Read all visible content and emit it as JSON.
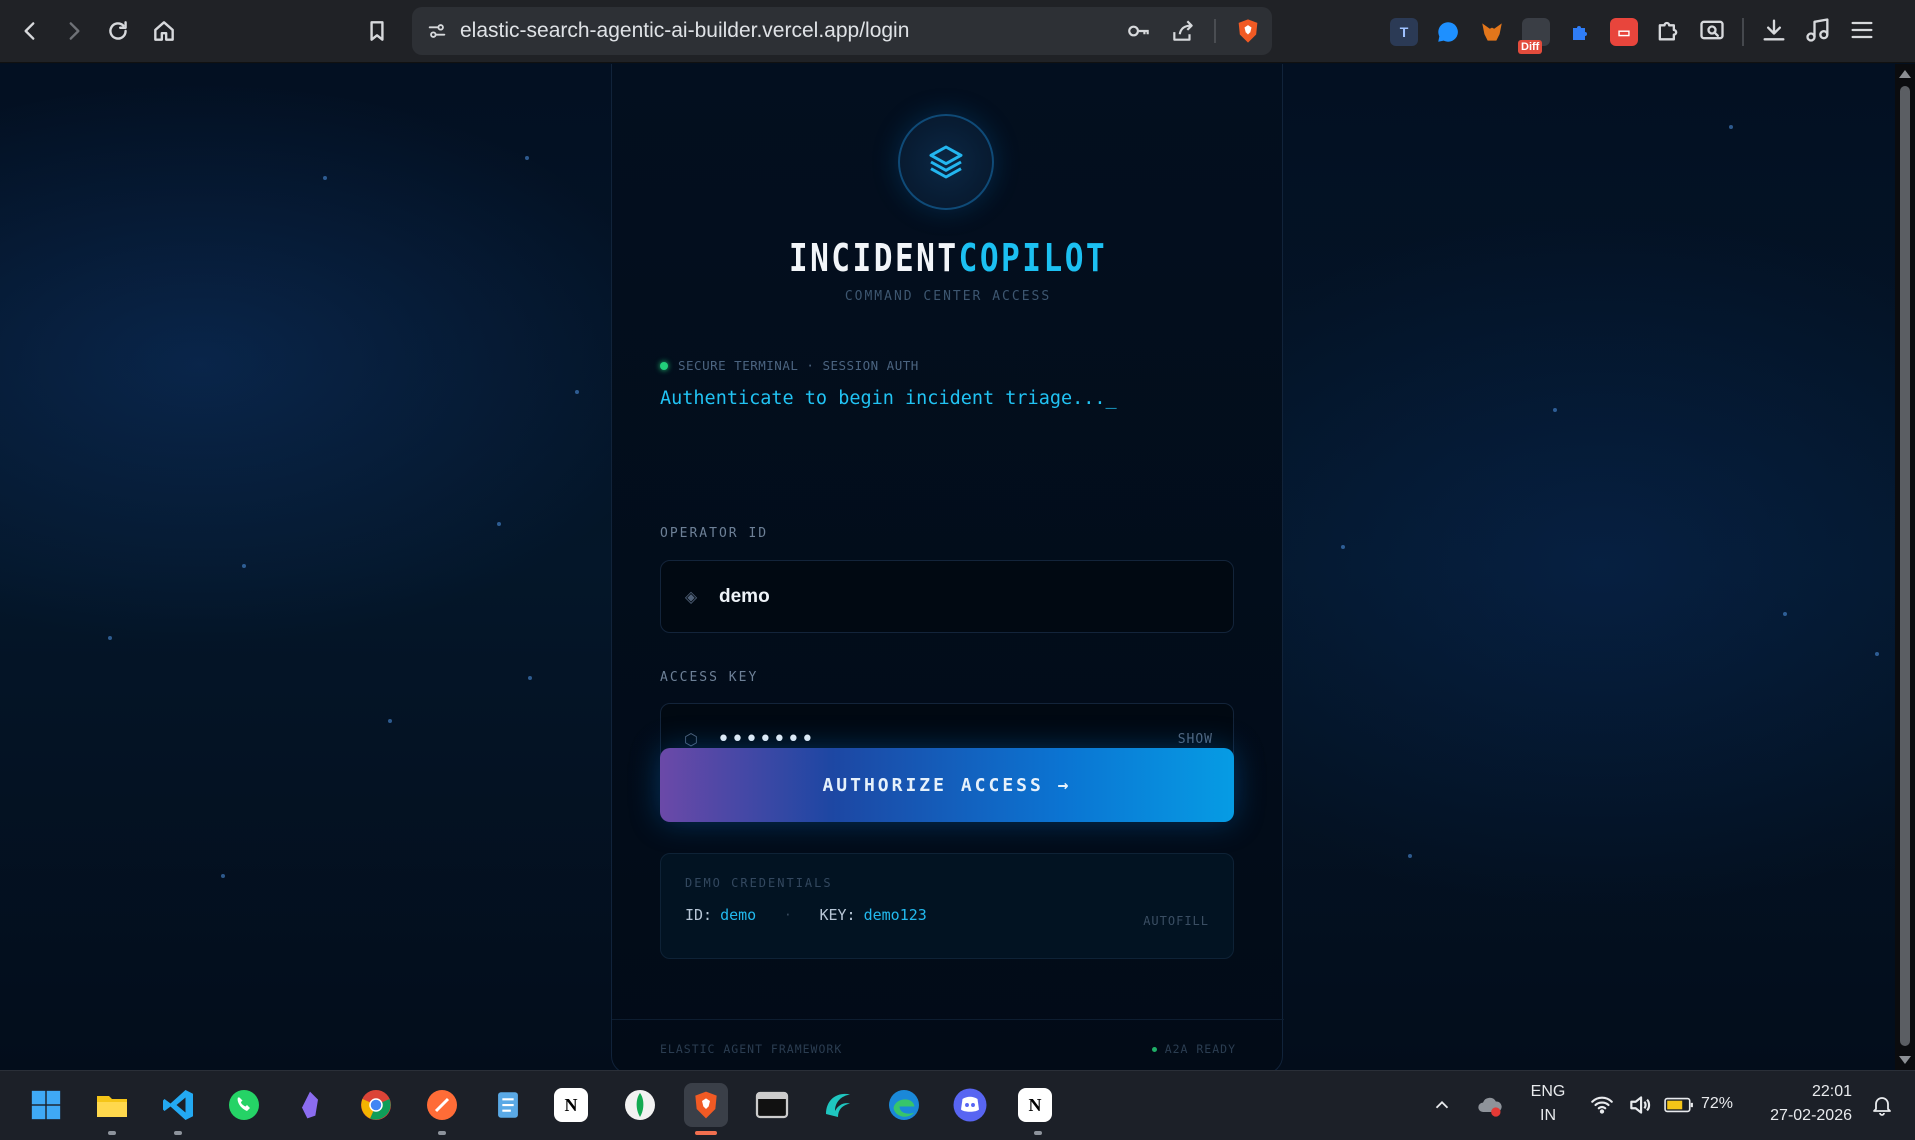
{
  "browser": {
    "url": "elastic-search-agentic-ai-builder.vercel.app/login",
    "extension_badge": "Diff"
  },
  "brand": {
    "name_part1": "INCIDENT",
    "name_part2": "COPILOT",
    "subtitle": "COMMAND CENTER ACCESS"
  },
  "status": {
    "line": "SECURE TERMINAL · SESSION AUTH",
    "typing": "Authenticate to begin incident triage..._"
  },
  "form": {
    "operator_label": "OPERATOR ID",
    "operator_value": "demo",
    "access_label": "ACCESS KEY",
    "access_value": "•••••••",
    "show_label": "SHOW",
    "submit_label": "AUTHORIZE ACCESS →"
  },
  "demo": {
    "title": "DEMO CREDENTIALS",
    "id_label": "ID:",
    "id_value": "demo",
    "separator": "·",
    "key_label": "KEY:",
    "key_value": "demo123",
    "autofill_label": "AUTOFILL"
  },
  "footer": {
    "left": "ELASTIC AGENT FRAMEWORK",
    "right": "A2A READY"
  },
  "taskbar": {
    "lang_top": "ENG",
    "lang_bottom": "IN",
    "battery": "72%",
    "time": "22:01",
    "date": "27-02-2026"
  },
  "colors": {
    "accent": "#1cc0f2",
    "ready_green": "#22d07a",
    "button_start": "#6b49a8",
    "button_end": "#069ce4"
  }
}
